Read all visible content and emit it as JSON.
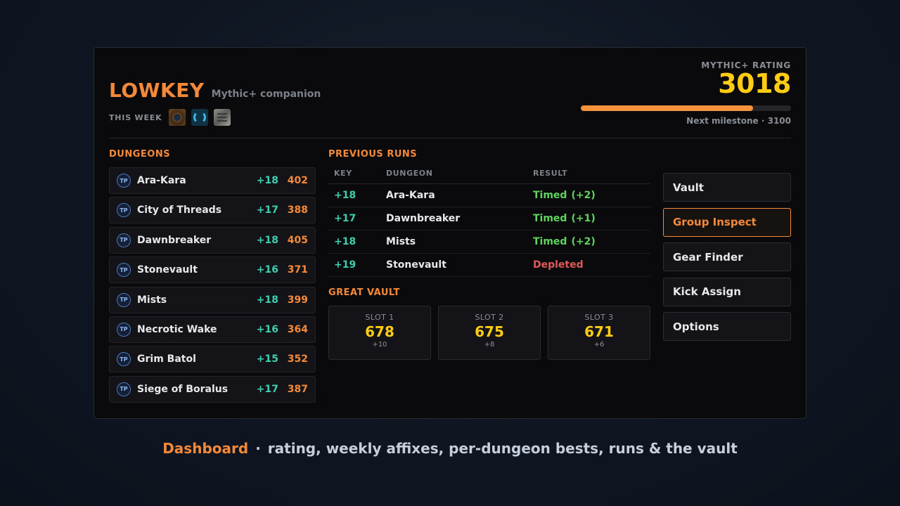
{
  "header": {
    "brand": "LOWKEY",
    "subtitle": "Mythic+ companion",
    "week_label": "THIS WEEK",
    "affixes": [
      "affix-bolster-icon",
      "affix-spiral-icon",
      "affix-stone-icon"
    ]
  },
  "rating": {
    "label": "MYTHIC+ RATING",
    "value": "3018",
    "progress": 0.82,
    "milestone": "Next milestone · 3100"
  },
  "dungeons": {
    "title": "DUNGEONS",
    "tp_label": "TP",
    "items": [
      {
        "name": "Ara-Kara",
        "key": "+18",
        "score": "402"
      },
      {
        "name": "City of Threads",
        "key": "+17",
        "score": "388"
      },
      {
        "name": "Dawnbreaker",
        "key": "+18",
        "score": "405"
      },
      {
        "name": "Stonevault",
        "key": "+16",
        "score": "371"
      },
      {
        "name": "Mists",
        "key": "+18",
        "score": "399"
      },
      {
        "name": "Necrotic Wake",
        "key": "+16",
        "score": "364"
      },
      {
        "name": "Grim Batol",
        "key": "+15",
        "score": "352"
      },
      {
        "name": "Siege of Boralus",
        "key": "+17",
        "score": "387"
      }
    ]
  },
  "runs": {
    "title": "PREVIOUS RUNS",
    "headers": {
      "key": "KEY",
      "dungeon": "DUNGEON",
      "result": "RESULT"
    },
    "rows": [
      {
        "key": "+18",
        "dungeon": "Ara-Kara",
        "result": "Timed",
        "bonus": "(+2)",
        "status": "timed"
      },
      {
        "key": "+17",
        "dungeon": "Dawnbreaker",
        "result": "Timed",
        "bonus": "(+1)",
        "status": "timed"
      },
      {
        "key": "+18",
        "dungeon": "Mists",
        "result": "Timed",
        "bonus": "(+2)",
        "status": "timed"
      },
      {
        "key": "+19",
        "dungeon": "Stonevault",
        "result": "Depleted",
        "bonus": "",
        "status": "depleted"
      }
    ]
  },
  "vault": {
    "title": "GREAT VAULT",
    "slots": [
      {
        "label": "SLOT 1",
        "value": "678",
        "sub": "+10"
      },
      {
        "label": "SLOT 2",
        "value": "675",
        "sub": "+8"
      },
      {
        "label": "SLOT 3",
        "value": "671",
        "sub": "+6"
      }
    ]
  },
  "actions": [
    {
      "label": "Vault",
      "active": false
    },
    {
      "label": "Group Inspect",
      "active": true
    },
    {
      "label": "Gear Finder",
      "active": false
    },
    {
      "label": "Kick Assign",
      "active": false
    },
    {
      "label": "Options",
      "active": false
    }
  ],
  "caption": {
    "highlight": "Dashboard",
    "separator": "·",
    "text": "rating, weekly affixes, per-dungeon bests, runs & the vault"
  },
  "colors": {
    "accent": "#f5893a",
    "rating": "#ffcc14",
    "key": "#3ecfb0",
    "timed": "#5ed45e",
    "depleted": "#e05a5a"
  }
}
